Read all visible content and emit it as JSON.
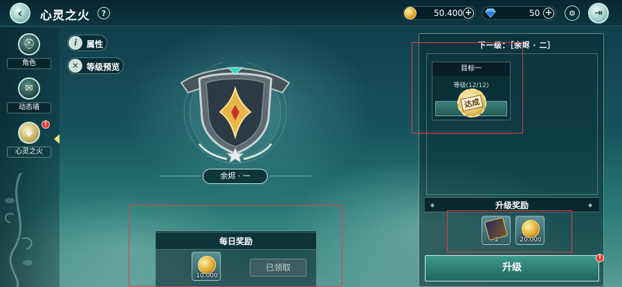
{
  "header": {
    "title": "心灵之火",
    "help_label": "?",
    "back_icon": "back-arrow-icon",
    "gold": "50.400",
    "gems": "50",
    "plus_label": "+",
    "exit_icon": "exit-door-icon"
  },
  "sidebar": {
    "items": [
      {
        "label": "角色",
        "icon": "helmet-icon"
      },
      {
        "label": "动态墙",
        "icon": "chat-bubble-icon"
      },
      {
        "label": "心灵之火",
        "icon": "flame-shield-icon",
        "badge": "!"
      }
    ]
  },
  "buttons": {
    "attributes": "属性",
    "attributes_icon_text": "i",
    "level_preview": "等级预览"
  },
  "emblem": {
    "rank": "余烬 · 一"
  },
  "daily_reward": {
    "title": "每日奖励",
    "item_qty": "10.000",
    "claimed_label": "已领取"
  },
  "next_level": {
    "label": "下一级：［余烬 · 二］",
    "goal_title": "目标一",
    "goal_level": "等级(12/12)",
    "seal_text": "达成",
    "reward_title": "升级奖励",
    "reward_card_qty": "2",
    "reward_coin_qty": "20.000",
    "upgrade_label": "升级",
    "upgrade_badge": "!"
  },
  "colors": {
    "accent_gold": "#f1e07a",
    "alert_red": "#e03a2c",
    "highlight_box": "#e0453a"
  }
}
